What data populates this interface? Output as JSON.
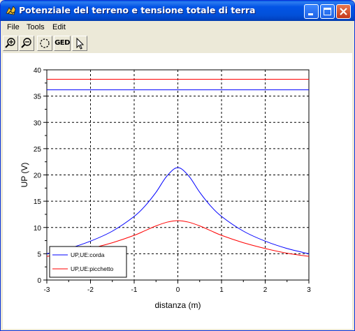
{
  "window": {
    "title": "Potenziale del terreno e tensione totale di terra",
    "icon": "scilab-icon",
    "controls": [
      "minimize-icon",
      "maximize-icon",
      "close-icon"
    ]
  },
  "menu": {
    "file": "File",
    "tools": "Tools",
    "edit": "Edit"
  },
  "toolbar": {
    "zoom_in_icon": "zoom-in-icon",
    "zoom_out_icon": "zoom-out-icon",
    "rotate_icon": "rotate-icon",
    "ged_label": "GED",
    "pointer_icon": "pointer-icon"
  },
  "colors": {
    "series_corda": "#0000ff",
    "series_picchetto": "#ff0000",
    "titlebar": "#0355e6"
  },
  "chart_data": {
    "type": "line",
    "title": "",
    "xlabel": "distanza (m)",
    "ylabel": "UP (V)",
    "xlim": [
      -3,
      3
    ],
    "ylim": [
      0,
      40
    ],
    "xticks": [
      "-3",
      "-2",
      "-1",
      "0",
      "1",
      "2",
      "3"
    ],
    "yticks": [
      "0",
      "5",
      "10",
      "15",
      "20",
      "25",
      "30",
      "35",
      "40"
    ],
    "grid": true,
    "grid_style": "dashed",
    "legend_position": "bottom-left",
    "series": [
      {
        "name": "UP,UE:corda",
        "color": "#0000ff",
        "x": [
          -3,
          -2.5,
          -2,
          -1.5,
          -1,
          -0.75,
          -0.5,
          -0.25,
          0,
          0.25,
          0.5,
          0.75,
          1,
          1.5,
          2,
          2.5,
          3
        ],
        "y": [
          5.0,
          6.0,
          7.4,
          9.3,
          12.1,
          14.1,
          16.7,
          19.8,
          21.4,
          19.8,
          16.7,
          14.1,
          12.1,
          9.3,
          7.4,
          6.0,
          5.0
        ]
      },
      {
        "name": "UP,UE:picchetto",
        "color": "#ff0000",
        "x": [
          -3,
          -2.5,
          -2,
          -1.5,
          -1,
          -0.75,
          -0.5,
          -0.25,
          0,
          0.25,
          0.5,
          0.75,
          1,
          1.5,
          2,
          2.5,
          3
        ],
        "y": [
          4.5,
          5.1,
          6.0,
          7.1,
          8.5,
          9.4,
          10.3,
          11.0,
          11.3,
          11.0,
          10.3,
          9.4,
          8.5,
          7.1,
          6.0,
          5.1,
          4.5
        ]
      },
      {
        "name": "",
        "color": "#0000ff",
        "x": [
          -3,
          3
        ],
        "y": [
          36.2,
          36.2
        ]
      },
      {
        "name": "",
        "color": "#ff0000",
        "x": [
          -3,
          3
        ],
        "y": [
          38.2,
          38.2
        ]
      }
    ]
  }
}
